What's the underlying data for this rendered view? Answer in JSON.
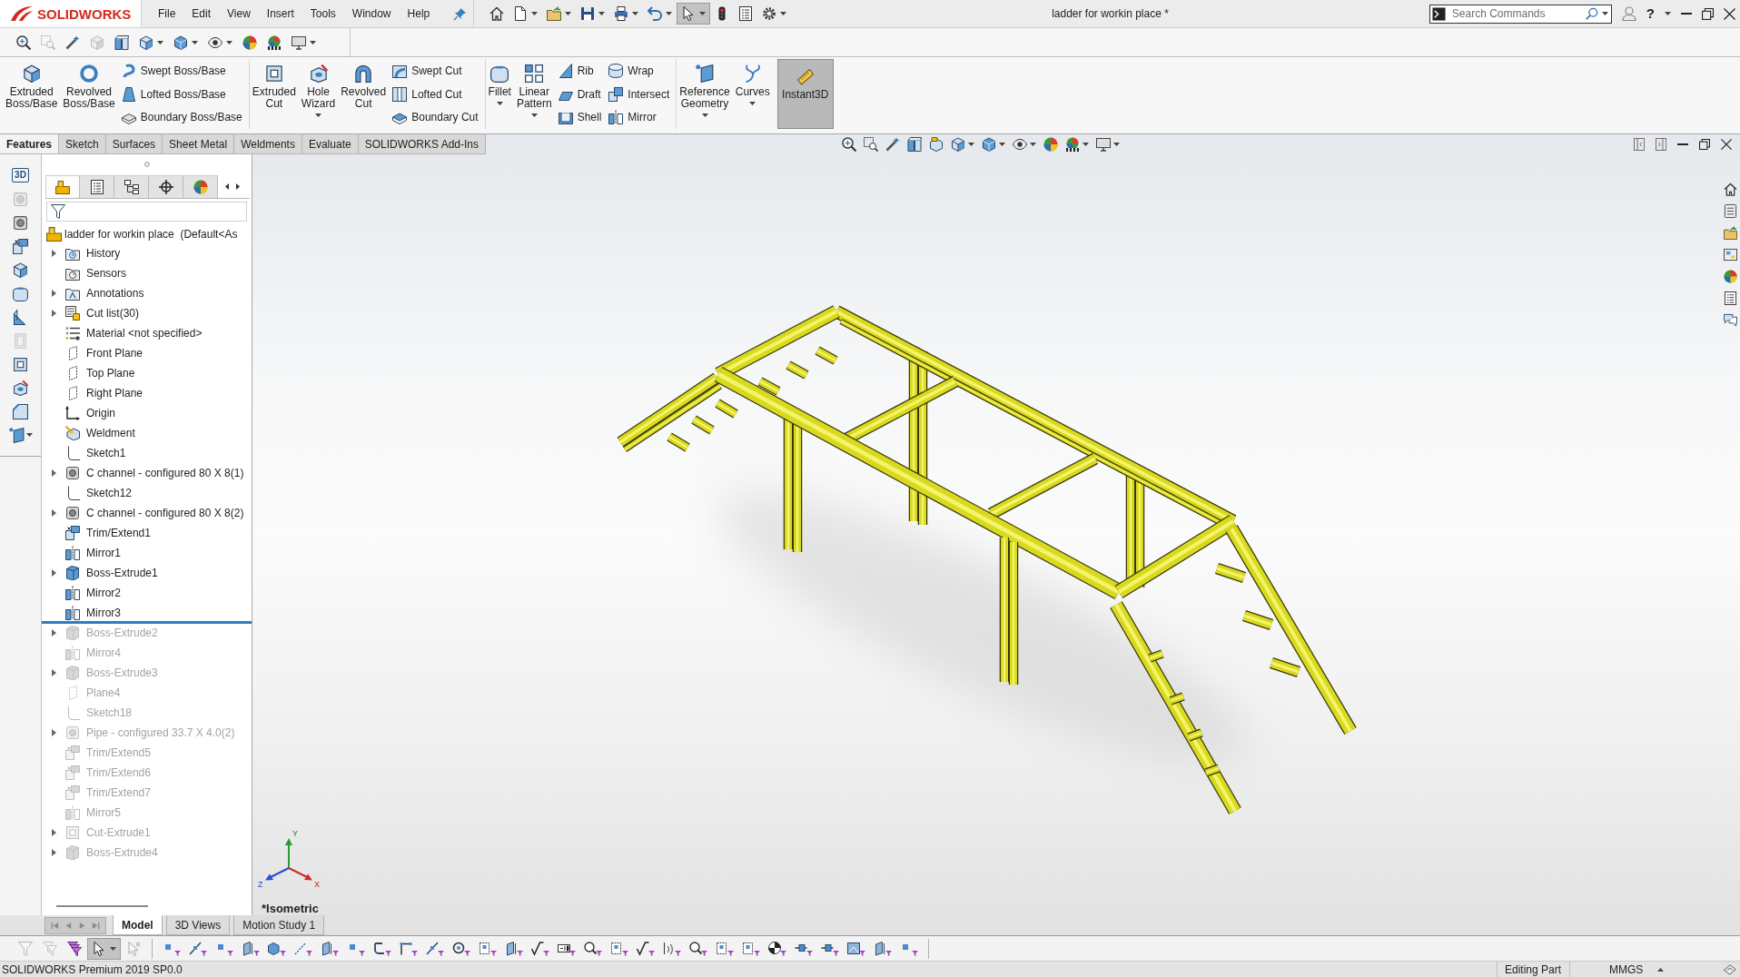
{
  "title_bar": {
    "logo": "SOLIDWORKS",
    "menu": [
      "File",
      "Edit",
      "View",
      "Insert",
      "Tools",
      "Window",
      "Help"
    ],
    "quick_access": [
      {
        "menu": false,
        "pressed": false
      },
      {
        "menu": true,
        "pressed": false
      },
      {
        "menu": true,
        "pressed": false
      },
      {
        "menu": true,
        "pressed": false
      },
      {
        "menu": true,
        "pressed": false
      },
      {
        "menu": true,
        "pressed": false
      },
      {
        "menu": true,
        "pressed": true
      },
      {
        "menu": false,
        "pressed": false
      },
      {
        "menu": false,
        "pressed": false
      },
      {
        "menu": true,
        "pressed": false
      }
    ],
    "title": "ladder for workin place *",
    "search": {
      "placeholder": "Search Commands"
    },
    "help": "?"
  },
  "view_tools": [
    {
      "menu": false,
      "disabled": false
    },
    {
      "menu": false,
      "disabled": true
    },
    {
      "menu": false,
      "disabled": false
    },
    {
      "menu": false,
      "disabled": true
    },
    {
      "menu": false,
      "disabled": false
    },
    {
      "menu": true,
      "disabled": false
    },
    {
      "menu": true,
      "disabled": false
    },
    {
      "menu": true,
      "disabled": false
    },
    {
      "menu": false,
      "disabled": false
    },
    {
      "menu": false,
      "disabled": false
    },
    {
      "menu": true,
      "disabled": false
    }
  ],
  "command_manager": {
    "groups": [
      {
        "tools": [
          {
            "kind": "large",
            "label": "Extruded Boss/Base",
            "menu": false
          },
          {
            "kind": "large",
            "label": "Revolved Boss/Base",
            "menu": false
          },
          {
            "kind": "stack",
            "items": [
              "Swept Boss/Base",
              "Lofted Boss/Base",
              "Boundary Boss/Base"
            ]
          }
        ]
      },
      {
        "tools": [
          {
            "kind": "large",
            "label": "Extruded Cut",
            "menu": false
          },
          {
            "kind": "large",
            "label": "Hole Wizard",
            "menu": true
          },
          {
            "kind": "large",
            "label": "Revolved Cut",
            "menu": false
          },
          {
            "kind": "stack",
            "items": [
              "Swept Cut",
              "Lofted Cut",
              "Boundary Cut"
            ]
          }
        ]
      },
      {
        "tools": [
          {
            "kind": "large",
            "label": "Fillet",
            "menu": true
          },
          {
            "kind": "large",
            "label": "Linear Pattern",
            "menu": true
          },
          {
            "kind": "stack",
            "items": [
              "Rib",
              "Draft",
              "Shell"
            ]
          },
          {
            "kind": "stack",
            "items": [
              "Wrap",
              "Intersect",
              "Mirror"
            ]
          }
        ]
      },
      {
        "tools": [
          {
            "kind": "large",
            "label": "Reference Geometry",
            "menu": true
          },
          {
            "kind": "large",
            "label": "Curves",
            "menu": true
          },
          {
            "kind": "toggle",
            "label": "Instant3D",
            "on": true
          }
        ]
      }
    ]
  },
  "tabs": [
    {
      "label": "Features",
      "selected": true
    },
    {
      "label": "Sketch",
      "selected": false
    },
    {
      "label": "Surfaces",
      "selected": false
    },
    {
      "label": "Sheet Metal",
      "selected": false
    },
    {
      "label": "Weldments",
      "selected": false
    },
    {
      "label": "Evaluate",
      "selected": false
    },
    {
      "label": "SOLIDWORKS Add-Ins",
      "selected": false
    }
  ],
  "heads_up_toolbar": [
    {
      "menu": false
    },
    {
      "menu": false
    },
    {
      "menu": false
    },
    {
      "menu": false
    },
    {
      "menu": false
    },
    {
      "menu": true
    },
    {
      "menu": true
    },
    {
      "menu": true
    },
    {
      "menu": false
    },
    {
      "menu": true
    },
    {
      "menu": true
    }
  ],
  "weldment_toolbar": [
    {
      "kind": "text",
      "label": "3D",
      "disabled": false
    },
    {
      "kind": "icon",
      "disabled": true,
      "menu": false
    },
    {
      "kind": "icon",
      "disabled": false,
      "menu": false
    },
    {
      "kind": "icon",
      "disabled": false,
      "menu": false
    },
    {
      "kind": "icon",
      "disabled": false,
      "menu": false
    },
    {
      "kind": "icon",
      "disabled": false,
      "menu": false
    },
    {
      "kind": "icon",
      "disabled": false,
      "menu": false
    },
    {
      "kind": "icon",
      "disabled": true,
      "menu": false
    },
    {
      "kind": "icon",
      "disabled": false,
      "menu": false
    },
    {
      "kind": "icon",
      "disabled": false,
      "menu": false
    },
    {
      "kind": "icon",
      "disabled": false,
      "menu": false
    },
    {
      "kind": "icon",
      "disabled": false,
      "menu": true
    }
  ],
  "feature_manager": {
    "tabs": [
      {
        "selected": true
      },
      {
        "selected": false
      },
      {
        "selected": false
      },
      {
        "selected": false
      },
      {
        "selected": false
      }
    ],
    "root": "ladder for workin place  (Default<As",
    "items": [
      {
        "label": "History",
        "kind": "history",
        "expandable": true,
        "rolled_back": false
      },
      {
        "label": "Sensors",
        "kind": "sensors",
        "expandable": false,
        "rolled_back": false
      },
      {
        "label": "Annotations",
        "kind": "annotations",
        "expandable": true,
        "rolled_back": false
      },
      {
        "label": "Cut list(30)",
        "kind": "cut-list",
        "expandable": true,
        "rolled_back": false
      },
      {
        "label": "Material <not specified>",
        "kind": "material",
        "expandable": false,
        "rolled_back": false
      },
      {
        "label": "Front Plane",
        "kind": "plane",
        "expandable": false,
        "rolled_back": false
      },
      {
        "label": "Top Plane",
        "kind": "plane",
        "expandable": false,
        "rolled_back": false
      },
      {
        "label": "Right Plane",
        "kind": "plane",
        "expandable": false,
        "rolled_back": false
      },
      {
        "label": "Origin",
        "kind": "origin",
        "expandable": false,
        "rolled_back": false
      },
      {
        "label": "Weldment",
        "kind": "weldment",
        "expandable": false,
        "rolled_back": false
      },
      {
        "label": "Sketch1",
        "kind": "sketch",
        "expandable": false,
        "rolled_back": false
      },
      {
        "label": "C channel - configured 80 X 8(1)",
        "kind": "structural-member",
        "expandable": true,
        "rolled_back": false
      },
      {
        "label": "Sketch12",
        "kind": "sketch",
        "expandable": false,
        "rolled_back": false
      },
      {
        "label": "C channel - configured 80 X 8(2)",
        "kind": "structural-member",
        "expandable": true,
        "rolled_back": false
      },
      {
        "label": "Trim/Extend1",
        "kind": "trim",
        "expandable": false,
        "rolled_back": false
      },
      {
        "label": "Mirror1",
        "kind": "mirror",
        "expandable": false,
        "rolled_back": false
      },
      {
        "label": "Boss-Extrude1",
        "kind": "extrude",
        "expandable": true,
        "rolled_back": false
      },
      {
        "label": "Mirror2",
        "kind": "mirror",
        "expandable": false,
        "rolled_back": false
      },
      {
        "label": "Mirror3",
        "kind": "mirror",
        "expandable": false,
        "rolled_back": false
      },
      {
        "label": "Boss-Extrude2",
        "kind": "extrude",
        "expandable": true,
        "rolled_back": true
      },
      {
        "label": "Mirror4",
        "kind": "mirror",
        "expandable": false,
        "rolled_back": true
      },
      {
        "label": "Boss-Extrude3",
        "kind": "extrude",
        "expandable": true,
        "rolled_back": true
      },
      {
        "label": "Plane4",
        "kind": "plane",
        "expandable": false,
        "rolled_back": true
      },
      {
        "label": "Sketch18",
        "kind": "sketch",
        "expandable": false,
        "rolled_back": true
      },
      {
        "label": "Pipe - configured 33.7 X 4.0(2)",
        "kind": "structural-member",
        "expandable": true,
        "rolled_back": true
      },
      {
        "label": "Trim/Extend5",
        "kind": "trim",
        "expandable": false,
        "rolled_back": true
      },
      {
        "label": "Trim/Extend6",
        "kind": "trim",
        "expandable": false,
        "rolled_back": true
      },
      {
        "label": "Trim/Extend7",
        "kind": "trim",
        "expandable": false,
        "rolled_back": true
      },
      {
        "label": "Mirror5",
        "kind": "mirror",
        "expandable": false,
        "rolled_back": true
      },
      {
        "label": "Cut-Extrude1",
        "kind": "cut-extrude",
        "expandable": true,
        "rolled_back": true
      },
      {
        "label": "Boss-Extrude4",
        "kind": "extrude",
        "expandable": true,
        "rolled_back": true
      }
    ]
  },
  "model_tabs": [
    {
      "label": "Model",
      "selected": true
    },
    {
      "label": "3D Views",
      "selected": false
    },
    {
      "label": "Motion Study 1",
      "selected": false
    }
  ],
  "viewport": {
    "view_name": "*Isometric",
    "triad": {
      "x": "X",
      "y": "Y",
      "z": "Z"
    }
  },
  "selection_toolbar": {
    "tools": [
      {
        "pressed": false,
        "menu": false,
        "disabled": true
      },
      {
        "pressed": false,
        "menu": false,
        "disabled": true
      },
      {
        "pressed": false,
        "menu": false,
        "disabled": false
      },
      {
        "pressed": true,
        "menu": true,
        "disabled": false
      },
      {
        "pressed": false,
        "menu": false,
        "disabled": true
      }
    ],
    "filters": [
      {
        "pressed": false
      },
      {
        "pressed": false
      },
      {
        "pressed": false
      },
      {
        "pressed": false
      },
      {
        "pressed": false
      },
      {
        "pressed": false
      },
      {
        "pressed": false
      },
      {
        "pressed": false
      },
      {
        "pressed": false
      },
      {
        "pressed": false
      },
      {
        "pressed": false
      },
      {
        "pressed": false
      },
      {
        "pressed": false
      },
      {
        "pressed": false
      },
      {
        "pressed": false
      },
      {
        "pressed": false
      },
      {
        "pressed": false
      },
      {
        "pressed": false
      },
      {
        "pressed": false
      },
      {
        "pressed": false
      },
      {
        "pressed": false
      },
      {
        "pressed": false
      },
      {
        "pressed": false
      },
      {
        "pressed": false
      },
      {
        "pressed": false
      },
      {
        "pressed": false
      },
      {
        "pressed": false
      },
      {
        "pressed": false
      },
      {
        "pressed": false
      }
    ]
  },
  "status_bar": {
    "product": "SOLIDWORKS Premium 2019 SP0.0",
    "mode": "Editing Part",
    "units": "MMGS"
  }
}
